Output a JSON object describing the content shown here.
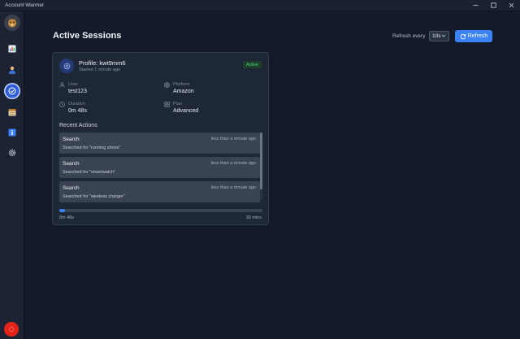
{
  "window": {
    "title": "Account Warmer"
  },
  "header": {
    "title": "Active Sessions",
    "refresh_label": "Refresh every",
    "refresh_interval": "10s",
    "refresh_button": "Refresh"
  },
  "session": {
    "profile": "Profile: kwt9mm6",
    "started": "Started 1 minute ago",
    "status": "Active",
    "user_label": "User",
    "user_value": "test123",
    "platform_label": "Platform",
    "platform_value": "Amazon",
    "duration_label": "Duration",
    "duration_value": "0m 48s",
    "plan_label": "Plan",
    "plan_value": "Advanced",
    "recent_actions_title": "Recent Actions",
    "actions": [
      {
        "title": "Search",
        "time": "less than a minute ago",
        "desc": "Searched for \"running shoes\""
      },
      {
        "title": "Search",
        "time": "less than a minute ago",
        "desc": "Searched for \"smartwatch\""
      },
      {
        "title": "Search",
        "time": "less than a minute ago",
        "desc": "Searched for \"wireless charger\""
      }
    ],
    "progress_fraction": 0.027,
    "progress_elapsed": "0m 48s",
    "progress_total": "30 mins"
  },
  "colors": {
    "accent": "#3b82f6",
    "active_badge": "#4ade80",
    "background": "#131b2b"
  },
  "sidebar_icons": [
    "chart-icon",
    "user-icon",
    "sessions-icon",
    "calendar-icon",
    "info-icon",
    "gear-icon"
  ]
}
